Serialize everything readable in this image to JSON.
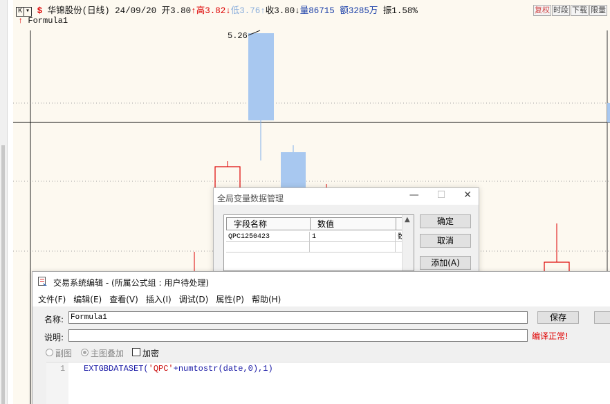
{
  "chart": {
    "k_btn": "K",
    "stock_name": "华锦股份(日线)",
    "date": "24/09/20",
    "open_label": "开3.80",
    "high_label": "高3.82",
    "low_label": "低3.76",
    "close_label": "收3.80",
    "volume_label": "量86715",
    "amount_label": "额3285万",
    "amplitude_label": "振1.58%",
    "formula_name": "Formula1",
    "peak_label": "5.26",
    "toolbar": [
      "复权",
      "时段",
      "下载",
      "限量"
    ],
    "colors": {
      "up": "#d00000",
      "down_fill": "#a8c8f0",
      "background": "#fdf9f0"
    }
  },
  "global_var_dialog": {
    "title": "全局变量数据管理",
    "columns": [
      "字段名称",
      "数值",
      ""
    ],
    "rows": [
      {
        "field": "QPC1250423",
        "value": "1",
        "extra": "数"
      }
    ],
    "buttons": {
      "ok": "确定",
      "cancel": "取消",
      "add": "添加(A)"
    }
  },
  "editor": {
    "title": "交易系统编辑 - (所属公式组 : 用户待处理)",
    "menu": [
      "文件(F)",
      "编辑(E)",
      "查看(V)",
      "插入(I)",
      "调试(D)",
      "属性(P)",
      "帮助(H)"
    ],
    "name_label": "名称:",
    "name_value": "Formula1",
    "desc_label": "说明:",
    "desc_value": "",
    "save_button": "保存",
    "compile_status": "编译正常!",
    "radio_sub": "副图",
    "radio_main": "主图叠加",
    "encrypt": "加密",
    "line_number": "1",
    "code_prefix": "EXTGBDATASET(",
    "code_string": "'QPC'",
    "code_suffix": "+numtostr(date,0),1)"
  }
}
